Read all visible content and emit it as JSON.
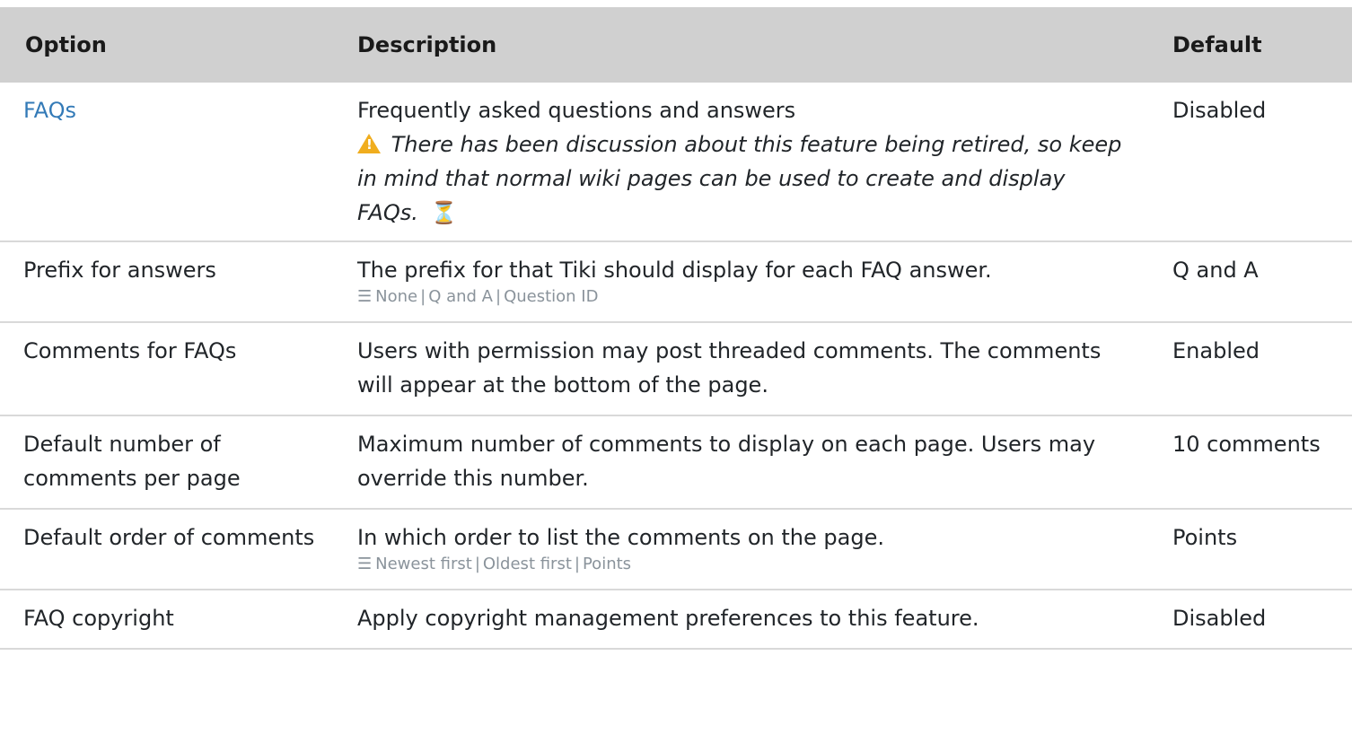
{
  "table": {
    "headers": [
      "Option",
      "Description",
      "Default"
    ],
    "rows": [
      {
        "option": "FAQs",
        "option_is_link": true,
        "description": "Frequently asked questions and answers",
        "note": "There has been discussion about this feature being retired, so keep in mind that normal wiki pages can be used to create and display FAQs.",
        "note_icon": "warning-icon",
        "trailing_icon": "flask-icon",
        "default": "Disabled"
      },
      {
        "option": "Prefix for answers",
        "description": "The prefix for that Tiki should display for each FAQ answer.",
        "choices": [
          "None",
          "Q and A",
          "Question ID"
        ],
        "choices_icon": "list-icon",
        "default": "Q and A"
      },
      {
        "option": "Comments for FAQs",
        "description": "Users with permission may post threaded comments. The comments will appear at the bottom of the page.",
        "default": "Enabled"
      },
      {
        "option": "Default number of comments per page",
        "description": "Maximum number of comments to display on each page. Users may override this number.",
        "default": "10 comments"
      },
      {
        "option": "Default order of comments",
        "description": "In which order to list the comments on the page.",
        "choices": [
          "Newest first",
          "Oldest first",
          "Points"
        ],
        "choices_icon": "list-icon",
        "default": "Points"
      },
      {
        "option": "FAQ copyright",
        "description": "Apply copyright management preferences to this feature.",
        "default": "Disabled"
      }
    ]
  },
  "colors": {
    "header_bg": "#d0d0d0",
    "link": "#337ab7",
    "warning": "#f0ad1e",
    "muted": "#8a939b",
    "row_border": "#d9d9d9"
  }
}
